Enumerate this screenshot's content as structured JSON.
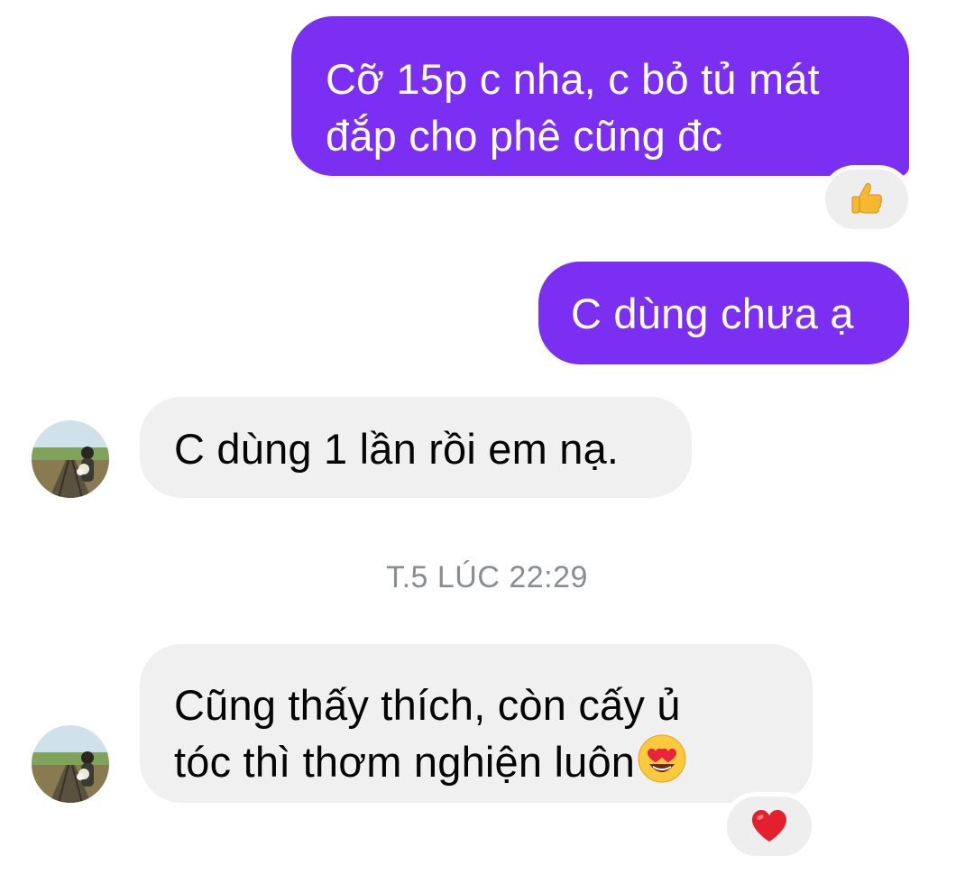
{
  "messages": [
    {
      "direction": "outgoing",
      "lines": [
        "Cỡ 15p c nha, c bỏ tủ mát",
        "đắp cho phê cũng đc"
      ],
      "reaction": "thumbs-up"
    },
    {
      "direction": "outgoing",
      "text": "C dùng chưa ạ"
    },
    {
      "direction": "incoming",
      "text": "C dùng 1 lần rồi em nạ."
    },
    {
      "direction": "incoming",
      "lines": [
        "Cũng thấy thích, còn cấy ủ",
        "tóc thì thơm nghiện luôn"
      ],
      "trailing_emoji": "heart-eyes",
      "reaction": "heart"
    }
  ],
  "timestamp": "T.5 LÚC 22:29",
  "colors": {
    "outgoing_bubble": "#7b2ff2",
    "incoming_bubble": "#f0f0f0",
    "timestamp_text": "#8a8d91",
    "reaction_bg": "#eeeeee"
  }
}
